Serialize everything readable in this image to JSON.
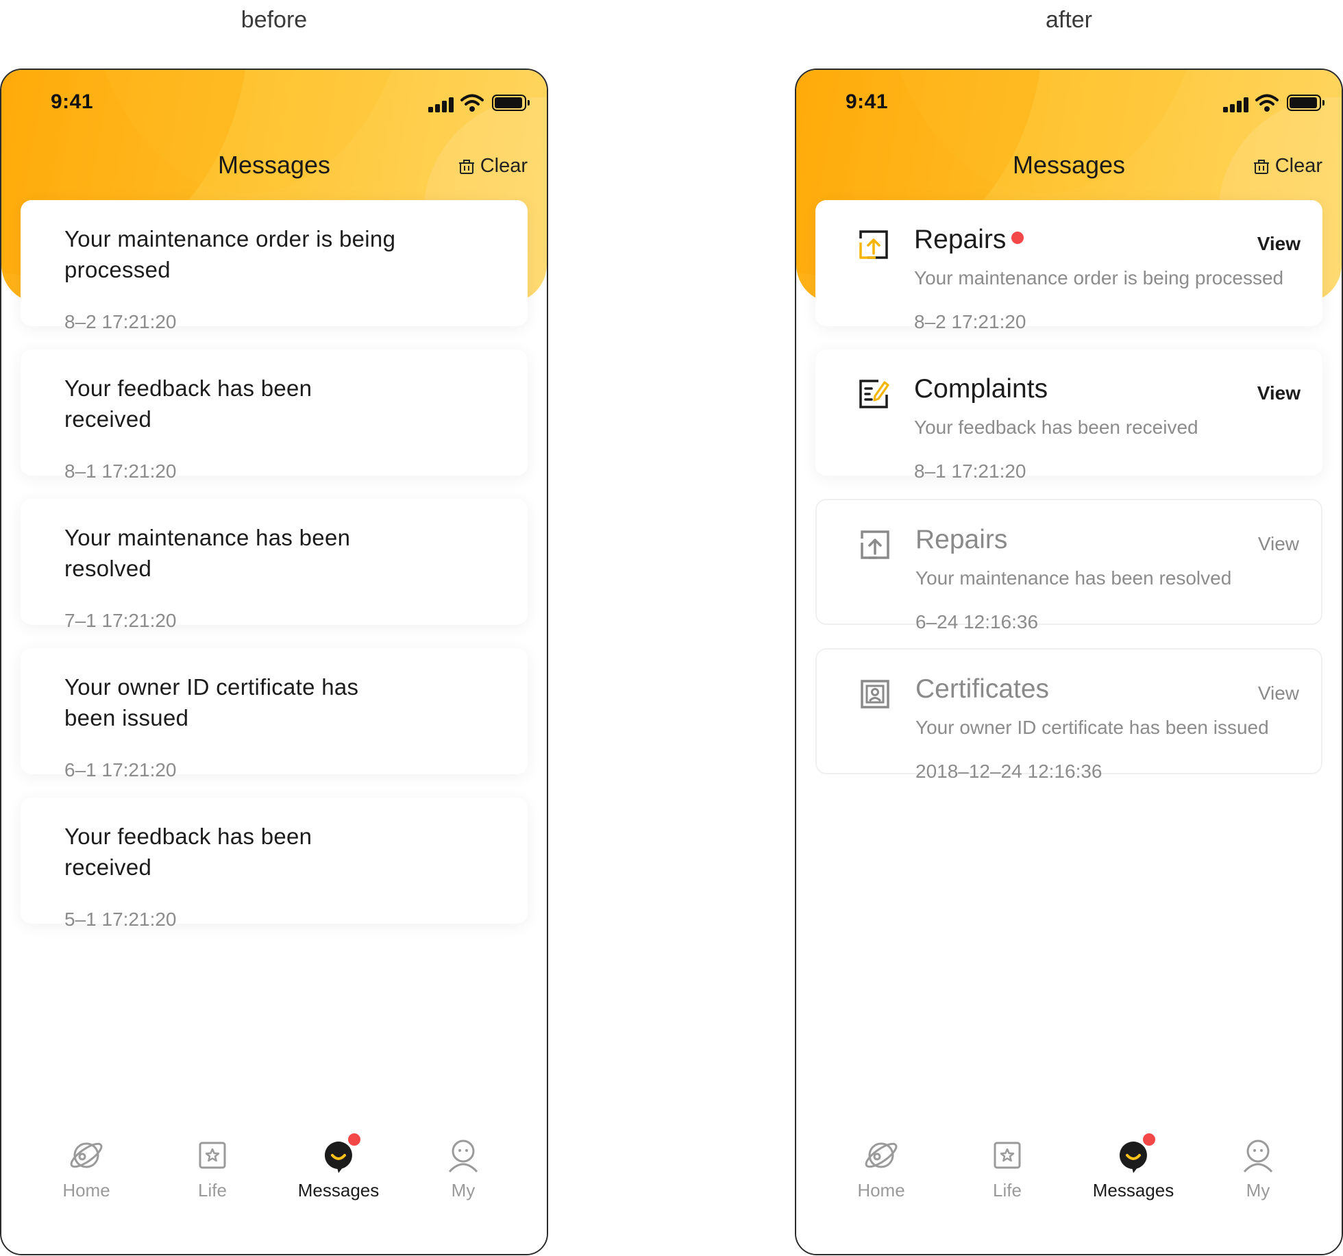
{
  "labels": {
    "before": "before",
    "after": "after"
  },
  "phone": {
    "status_time": "9:41",
    "title": "Messages",
    "clear_label": "Clear"
  },
  "before": {
    "messages": [
      {
        "text": "Your maintenance order is being processed",
        "time": "8–2 17:21:20"
      },
      {
        "text": "Your feedback has been received",
        "time": "8–1 17:21:20"
      },
      {
        "text": "Your maintenance has been resolved",
        "time": "7–1 17:21:20"
      },
      {
        "text": "Your owner ID certificate has been issued",
        "time": "6–1 17:21:20"
      },
      {
        "text": "Your feedback has been received",
        "time": "5–1 17:21:20"
      }
    ]
  },
  "after": {
    "view_label": "View",
    "messages": [
      {
        "category": "Repairs",
        "icon": "repair-icon",
        "unread": true,
        "text": "Your maintenance order is being processed",
        "time": "8–2 17:21:20"
      },
      {
        "category": "Complaints",
        "icon": "complaint-icon",
        "unread": false,
        "text": "Your feedback has been received",
        "time": "8–1 17:21:20"
      },
      {
        "category": "Repairs",
        "icon": "repair-icon",
        "unread": false,
        "read_style": true,
        "text": "Your maintenance has been resolved",
        "time": "6–24 12:16:36"
      },
      {
        "category": "Certificates",
        "icon": "certificate-icon",
        "unread": false,
        "read_style": true,
        "text": "Your owner ID certificate has been issued",
        "time": "2018–12–24 12:16:36"
      }
    ]
  },
  "tabbar": {
    "items": [
      {
        "label": "Home",
        "icon": "planet-icon",
        "active": false
      },
      {
        "label": "Life",
        "icon": "star-box-icon",
        "active": false
      },
      {
        "label": "Messages",
        "icon": "chat-bubble-icon",
        "active": true,
        "badge": true
      },
      {
        "label": "My",
        "icon": "person-icon",
        "active": false
      }
    ]
  },
  "colors": {
    "header_start": "#ffad10",
    "header_end": "#ffd660",
    "accent_yellow": "#f5b400",
    "badge_red": "#f44848",
    "text_dark": "#1c1c1c",
    "text_grey": "#8c8c8c"
  }
}
